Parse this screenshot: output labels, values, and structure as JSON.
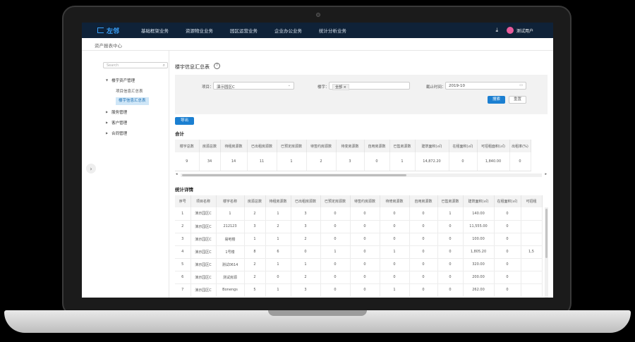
{
  "topbar": {
    "logo": "左邻",
    "nav": [
      "基础框架业务",
      "资源物业业务",
      "园区运营业务",
      "企业办公业务",
      "统计分析业务"
    ],
    "user": "测试用户"
  },
  "breadcrumb": "资产报表中心",
  "sidebar": {
    "search_placeholder": "Search",
    "items": [
      {
        "label": "楼宇资产管理",
        "level": 0
      },
      {
        "label": "项目信息汇总表",
        "level": 1
      },
      {
        "label": "楼宇信息汇总表",
        "level": 1,
        "active": true
      },
      {
        "label": "服务管理",
        "level": 0
      },
      {
        "label": "客户管理",
        "level": 0
      },
      {
        "label": "合同管理",
        "level": 0
      }
    ]
  },
  "page": {
    "title": "楼宇信息汇总表"
  },
  "filter": {
    "project_label": "项目：",
    "project_value": "演示园区C",
    "building_label": "楼宇：",
    "building_tag": "全部",
    "deadline_label": "截止时间：",
    "deadline_value": "2019-10",
    "search_btn": "搜索",
    "reset_btn": "重置",
    "export_btn": "导出"
  },
  "summary": {
    "title": "合计",
    "headers": [
      "楼宇总数",
      "房源总数",
      "待租房源数",
      "已出租房源数",
      "已预定房源数",
      "待签约房源数",
      "待变房源数",
      "自用房源数",
      "已售房源数",
      "建筑面积(㎡)",
      "在租面积(㎡)",
      "可招租面积(㎡)",
      "出租率(%)"
    ],
    "row": [
      "9",
      "34",
      "14",
      "11",
      "1",
      "2",
      "3",
      "0",
      "1",
      "14,872.20",
      "0",
      "1,840.00",
      "0"
    ]
  },
  "details": {
    "title": "统计详情",
    "headers": [
      "序号",
      "项目名称",
      "楼宇名称",
      "房源总数",
      "待租房源数",
      "已出租房源数",
      "已预定房源数",
      "待签约房源数",
      "待修房源数",
      "自用房源数",
      "已售房源数",
      "建筑面积(㎡)",
      "在租面积(㎡)",
      "可招租"
    ],
    "rows": [
      [
        "1",
        "演示园区C",
        "1",
        "2",
        "1",
        "3",
        "0",
        "0",
        "0",
        "0",
        "1",
        "140.00",
        "0",
        ""
      ],
      [
        "2",
        "演示园区C",
        "212123",
        "3",
        "2",
        "3",
        "0",
        "0",
        "0",
        "0",
        "0",
        "11,555.00",
        "0",
        ""
      ],
      [
        "3",
        "演示园区C",
        "易吧楼",
        "1",
        "1",
        "2",
        "0",
        "0",
        "0",
        "0",
        "0",
        "100.00",
        "0",
        ""
      ],
      [
        "4",
        "演示园区C",
        "1号楼",
        "8",
        "6",
        "0",
        "1",
        "0",
        "1",
        "0",
        "0",
        "1,805.20",
        "0",
        "1,5"
      ],
      [
        "5",
        "演示园区C",
        "测试0614",
        "2",
        "1",
        "1",
        "0",
        "0",
        "0",
        "0",
        "0",
        "320.00",
        "0",
        ""
      ],
      [
        "6",
        "演示园区C",
        "测试房源",
        "2",
        "0",
        "2",
        "0",
        "0",
        "0",
        "0",
        "0",
        "200.00",
        "0",
        ""
      ],
      [
        "7",
        "演示园区C",
        "Bonengs",
        "5",
        "1",
        "3",
        "0",
        "0",
        "1",
        "0",
        "0",
        "262.00",
        "0",
        ""
      ]
    ]
  }
}
